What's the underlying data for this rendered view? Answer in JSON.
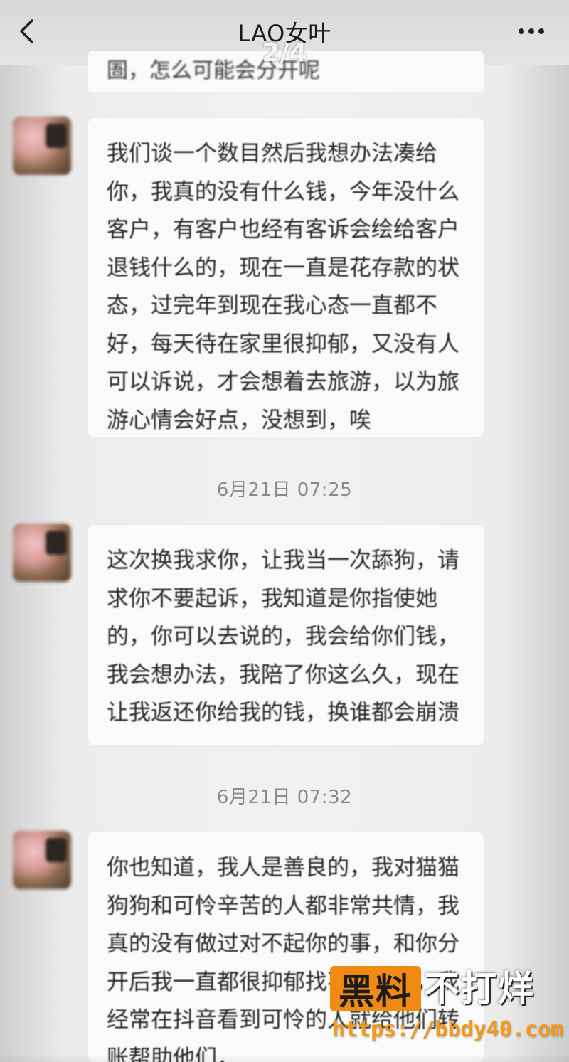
{
  "header": {
    "title": "LAO女叶",
    "page_indicator": "2/4"
  },
  "messages": [
    {
      "text": "圄，怎么可能会分开呢"
    },
    {
      "text": "我们谈一个数目然后我想办法凑给你，我真的没有什么钱，今年没什么客户，有客户也经有客诉会绘给客户退钱什么的，现在一直是花存款的状态，过完年到现在我心态一直都不好，每天待在家里很抑郁，又没有人可以诉说，才会想着去旅游，以为旅游心情会好点，没想到，唉"
    },
    {
      "timestamp": "6月21日 07:25"
    },
    {
      "text": "这次换我求你，让我当一次舔狗，请求你不要起诉，我知道是你指使她的，你可以去说的，我会给你们钱，我会想办法，我陪了你这么久，现在让我返还你给我的钱，换谁都会崩溃"
    },
    {
      "timestamp": "6月21日 07:32"
    },
    {
      "text": "你也知道，我人是善良的，我对猫猫狗狗和可怜辛苦的人都非常共情，我真的没有做过对不起你的事，和你分开后我一直都很抑郁找不到方向，我经常在抖音看到可怜的人就给他们转账帮助他们，"
    }
  ],
  "watermark": {
    "badge": "黑料",
    "slogan": "不打烊",
    "url": "https://bbdy40.com",
    "badge_color": "#f08a12"
  },
  "icons": {
    "back": "chevron-left-icon",
    "more": "more-dots-icon"
  }
}
